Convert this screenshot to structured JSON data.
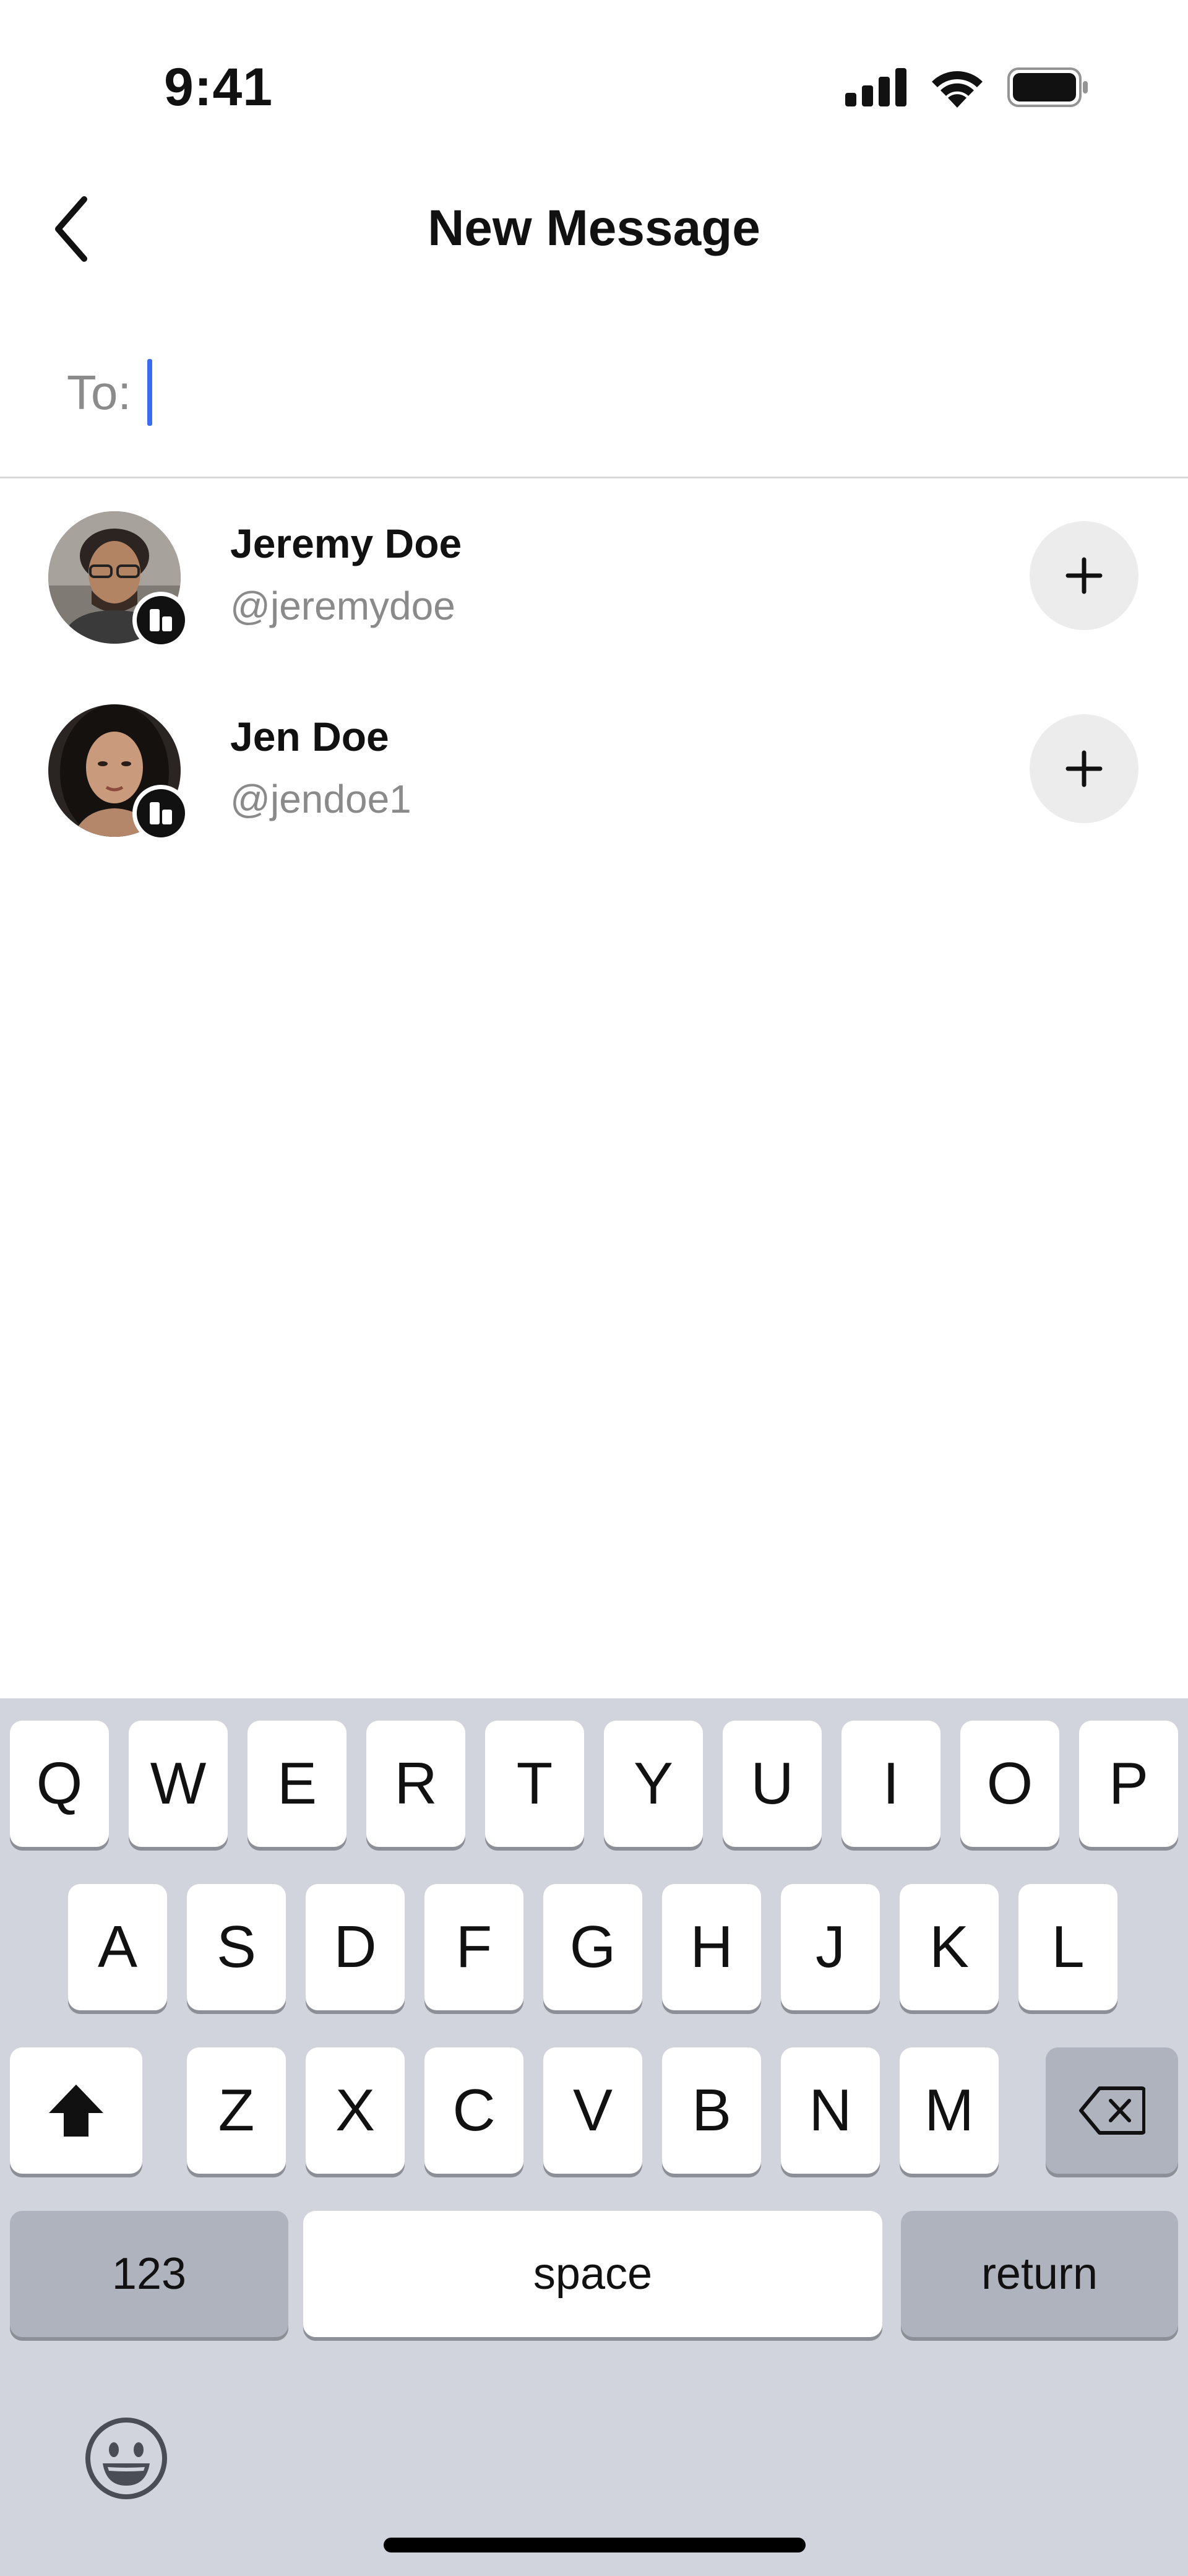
{
  "status_bar": {
    "time": "9:41",
    "icons": [
      "signal-icon",
      "wifi-icon",
      "battery-icon"
    ]
  },
  "header": {
    "title": "New Message",
    "back_icon": "chevron-left-icon"
  },
  "to_field": {
    "label": "To:",
    "value": ""
  },
  "contacts": [
    {
      "name": "Jeremy Doe",
      "handle": "@jeremydoe"
    },
    {
      "name": "Jen Doe",
      "handle": "@jendoe1"
    }
  ],
  "keyboard": {
    "row1": [
      "Q",
      "W",
      "E",
      "R",
      "T",
      "Y",
      "U",
      "I",
      "O",
      "P"
    ],
    "row2": [
      "A",
      "S",
      "D",
      "F",
      "G",
      "H",
      "J",
      "K",
      "L"
    ],
    "row3": [
      "Z",
      "X",
      "C",
      "V",
      "B",
      "N",
      "M"
    ],
    "numbers_label": "123",
    "space_label": "space",
    "return_label": "return"
  },
  "colors": {
    "caret": "#3b6cf0",
    "keyboard_bg": "#d1d4dc",
    "key": "#ffffff",
    "dark_key": "#aeb3bd"
  }
}
